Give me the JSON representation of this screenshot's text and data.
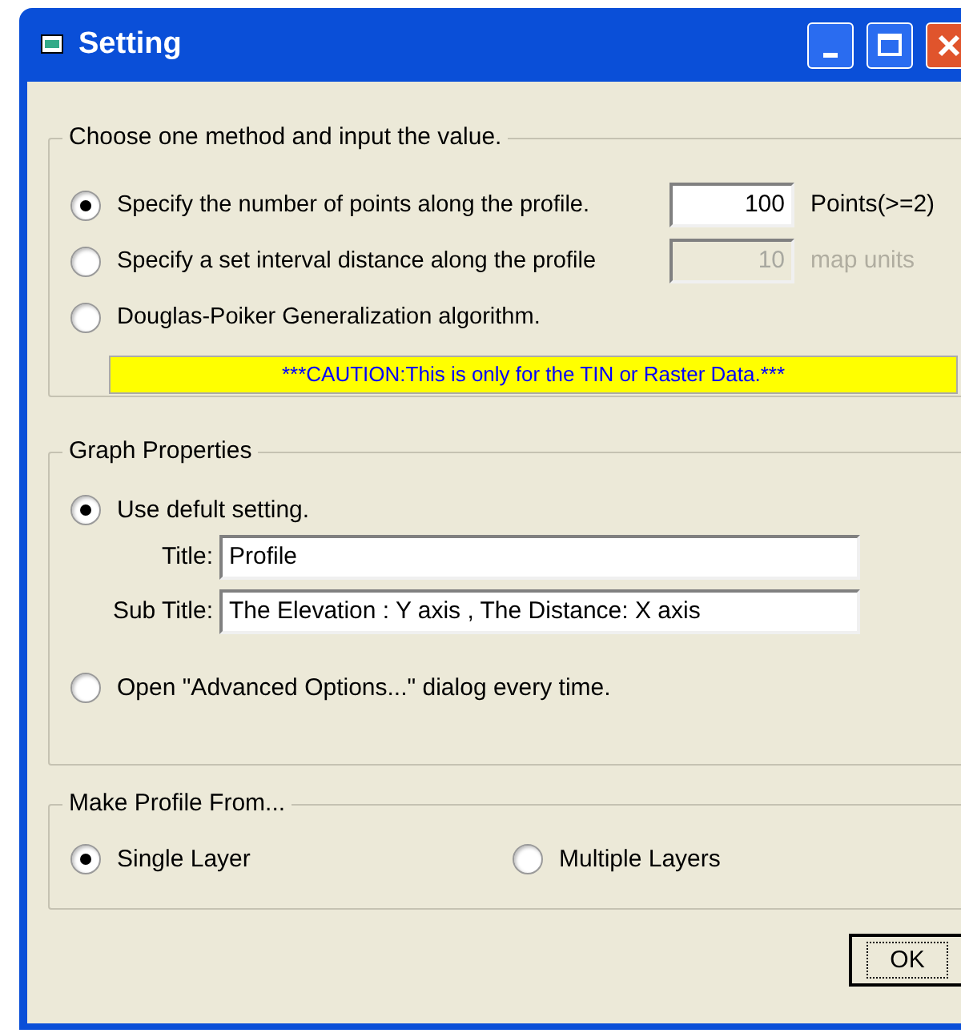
{
  "window": {
    "title": "Setting"
  },
  "method_group": {
    "legend": "Choose one method and input the value.",
    "options": [
      {
        "label": "Specify the number of points along the profile.",
        "selected": true,
        "value": "100",
        "unit": "Points(>=2)",
        "disabled": false
      },
      {
        "label": "Specify a set interval distance along the profile",
        "selected": false,
        "value": "10",
        "unit": "map units",
        "disabled": true
      },
      {
        "label": "Douglas-Poiker Generalization algorithm.",
        "selected": false
      }
    ],
    "caution": "***CAUTION:This is only for the TIN or Raster Data.***"
  },
  "graph_group": {
    "legend": "Graph Properties",
    "options": [
      {
        "label": "Use defult setting.",
        "selected": true
      },
      {
        "label": "Open \"Advanced Options...\" dialog every time.",
        "selected": false
      }
    ],
    "fields": [
      {
        "label": "Title:",
        "value": "Profile"
      },
      {
        "label": "Sub Title:",
        "value": "The Elevation : Y axis , The Distance: X axis"
      }
    ]
  },
  "source_group": {
    "legend": "Make Profile From...",
    "options": [
      {
        "label": "Single Layer",
        "selected": true
      },
      {
        "label": "Multiple Layers",
        "selected": false
      }
    ]
  },
  "buttons": [
    {
      "label": "OK"
    }
  ]
}
